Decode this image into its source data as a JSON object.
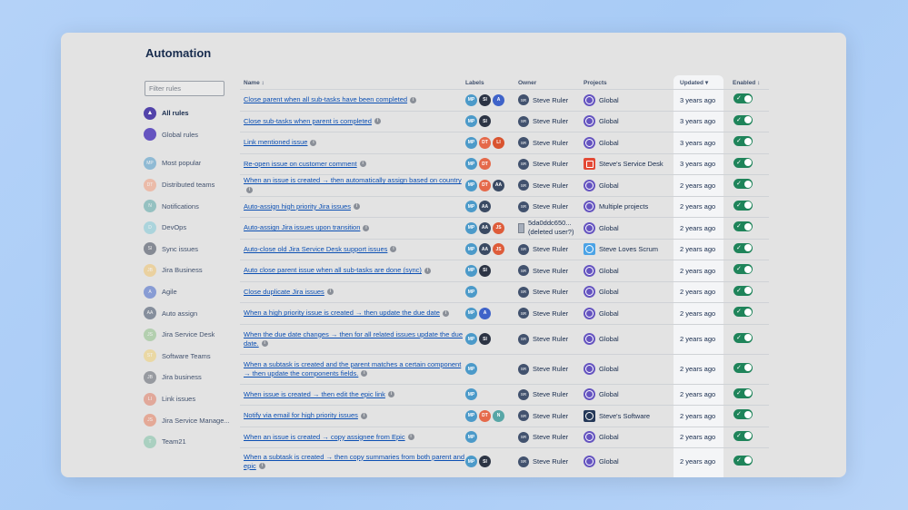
{
  "page": {
    "title": "Automation"
  },
  "filter": {
    "placeholder": "Filter rules"
  },
  "sidebar": {
    "items": [
      {
        "label": "All rules",
        "initials": "",
        "color": "#5243aa",
        "active": true,
        "icon": "atlassian-icon"
      },
      {
        "label": "Global rules",
        "initials": "",
        "color": "#6554c0",
        "active": false,
        "icon": "globe-icon"
      },
      {
        "label": "Most popular",
        "initials": "MP",
        "color": "#4c9ac9"
      },
      {
        "label": "Distributed teams",
        "initials": "DT",
        "color": "#f29b7a"
      },
      {
        "label": "Notifications",
        "initials": "N",
        "color": "#57a6a6"
      },
      {
        "label": "DevOps",
        "initials": "D",
        "color": "#7ec8d8"
      },
      {
        "label": "Sync issues",
        "initials": "SI",
        "color": "#3a4254"
      },
      {
        "label": "Jira Business",
        "initials": "JB",
        "color": "#f0c36b"
      },
      {
        "label": "Agile",
        "initials": "A",
        "color": "#3f63c9"
      },
      {
        "label": "Auto assign",
        "initials": "AA",
        "color": "#3a4a63"
      },
      {
        "label": "Jira Service Desk",
        "initials": "JS",
        "color": "#8cbf86"
      },
      {
        "label": "Software Teams",
        "initials": "ST",
        "color": "#f0d072"
      },
      {
        "label": "Jira business",
        "initials": "JB",
        "color": "#5a5f6b"
      },
      {
        "label": "Link issues",
        "initials": "LI",
        "color": "#e07860"
      },
      {
        "label": "Jira Service Manage...",
        "initials": "JS",
        "color": "#e57a5a"
      },
      {
        "label": "Team21",
        "initials": "T",
        "color": "#7dc1a5"
      }
    ]
  },
  "table": {
    "headers": {
      "name": "Name",
      "labels": "Labels",
      "owner": "Owner",
      "projects": "Projects",
      "updated": "Updated",
      "enabled": "Enabled"
    },
    "rows": [
      {
        "name": "Close parent when all sub-tasks have been completed",
        "labels": [
          "MP",
          "SI",
          "A"
        ],
        "owner": "Steve Ruler",
        "project": "Global",
        "updated": "3 years ago"
      },
      {
        "name": "Close sub-tasks when parent is completed",
        "labels": [
          "MP",
          "SI"
        ],
        "owner": "Steve Ruler",
        "project": "Global",
        "updated": "3 years ago"
      },
      {
        "name": "Link mentioned issue",
        "labels": [
          "MP",
          "DT",
          "LI"
        ],
        "owner": "Steve Ruler",
        "project": "Global",
        "updated": "3 years ago"
      },
      {
        "name": "Re-open issue on customer comment",
        "labels": [
          "MP",
          "DT"
        ],
        "owner": "Steve Ruler",
        "project": "Steve's Service Desk",
        "updated": "3 years ago"
      },
      {
        "name": "When an issue is created → then automatically assign based on country",
        "labels": [
          "MP",
          "DT",
          "AA"
        ],
        "owner": "Steve Ruler",
        "project": "Global",
        "updated": "2 years ago"
      },
      {
        "name": "Auto-assign high priority Jira issues",
        "labels": [
          "MP",
          "AA"
        ],
        "owner": "Steve Ruler",
        "project": "Multiple projects",
        "updated": "2 years ago"
      },
      {
        "name": "Auto-assign Jira issues upon transition",
        "labels": [
          "MP",
          "AA",
          "JS"
        ],
        "owner": "5da0ddc650... (deleted user?)",
        "project": "Global",
        "updated": "2 years ago"
      },
      {
        "name": "Auto-close old Jira Service Desk support issues",
        "labels": [
          "MP",
          "AA",
          "JS"
        ],
        "owner": "Steve Ruler",
        "project": "Steve Loves Scrum",
        "updated": "2 years ago"
      },
      {
        "name": "Auto close parent issue when all sub-tasks are done (sync)",
        "labels": [
          "MP",
          "SI"
        ],
        "owner": "Steve Ruler",
        "project": "Global",
        "updated": "2 years ago"
      },
      {
        "name": "Close duplicate Jira issues",
        "labels": [
          "MP"
        ],
        "owner": "Steve Ruler",
        "project": "Global",
        "updated": "2 years ago"
      },
      {
        "name": "When a high priority issue is created → then update the due date",
        "labels": [
          "MP",
          "A"
        ],
        "owner": "Steve Ruler",
        "project": "Global",
        "updated": "2 years ago"
      },
      {
        "name": "When the due date changes → then for all related issues update the due date.",
        "labels": [
          "MP",
          "SI"
        ],
        "owner": "Steve Ruler",
        "project": "Global",
        "updated": "2 years ago"
      },
      {
        "name": "When a subtask is created and the parent matches a certain component → then update the components fields.",
        "labels": [
          "MP"
        ],
        "owner": "Steve Ruler",
        "project": "Global",
        "updated": "2 years ago"
      },
      {
        "name": "When issue is created → then edit the epic link",
        "labels": [
          "MP"
        ],
        "owner": "Steve Ruler",
        "project": "Global",
        "updated": "2 years ago"
      },
      {
        "name": "Notify via email for high priority issues",
        "labels": [
          "MP",
          "DT",
          "N"
        ],
        "owner": "Steve Ruler",
        "project": "Steve's Software",
        "updated": "2 years ago"
      },
      {
        "name": "When an issue is created → copy assignee from Epic",
        "labels": [
          "MP"
        ],
        "owner": "Steve Ruler",
        "project": "Global",
        "updated": "2 years ago"
      },
      {
        "name": "When a subtask is created → then copy summaries from both parent and epic",
        "labels": [
          "MP",
          "SI"
        ],
        "owner": "Steve Ruler",
        "project": "Global",
        "updated": "2 years ago"
      }
    ]
  },
  "colors": {
    "MP": "#4c9ac9",
    "SI": "#2c3444",
    "A": "#3f63c9",
    "DT": "#e5694a",
    "LI": "#d9532f",
    "AA": "#3a4a63",
    "JS": "#de5c3a",
    "N": "#57a6a6",
    "toggle_on": "#1f845a",
    "link": "#0b4fb3"
  }
}
